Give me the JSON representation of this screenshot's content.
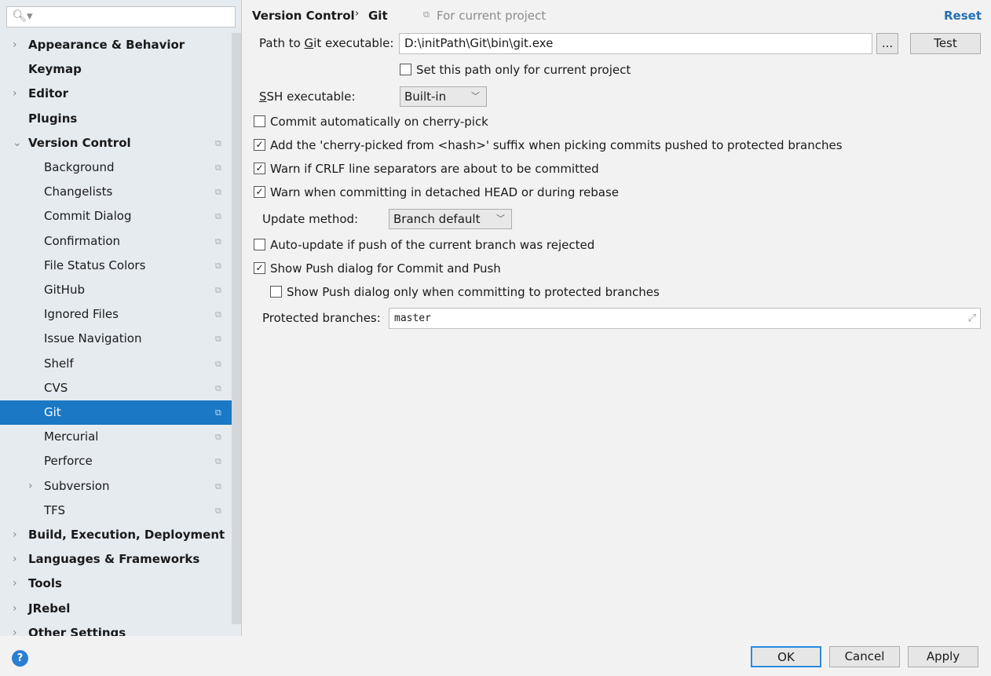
{
  "sidebar": {
    "search_placeholder": "",
    "items": [
      {
        "label": "Appearance & Behavior",
        "level": "top",
        "arrow": "›"
      },
      {
        "label": "Keymap",
        "level": "top",
        "arrow": ""
      },
      {
        "label": "Editor",
        "level": "top",
        "arrow": "›"
      },
      {
        "label": "Plugins",
        "level": "top",
        "arrow": ""
      },
      {
        "label": "Version Control",
        "level": "top",
        "arrow": "⌄",
        "copy": true
      },
      {
        "label": "Background",
        "level": "sub",
        "copy": true
      },
      {
        "label": "Changelists",
        "level": "sub",
        "copy": true
      },
      {
        "label": "Commit Dialog",
        "level": "sub",
        "copy": true
      },
      {
        "label": "Confirmation",
        "level": "sub",
        "copy": true
      },
      {
        "label": "File Status Colors",
        "level": "sub",
        "copy": true
      },
      {
        "label": "GitHub",
        "level": "sub",
        "copy": true
      },
      {
        "label": "Ignored Files",
        "level": "sub",
        "copy": true
      },
      {
        "label": "Issue Navigation",
        "level": "sub",
        "copy": true
      },
      {
        "label": "Shelf",
        "level": "sub",
        "copy": true
      },
      {
        "label": "CVS",
        "level": "sub",
        "copy": true
      },
      {
        "label": "Git",
        "level": "sub",
        "copy": true,
        "selected": true
      },
      {
        "label": "Mercurial",
        "level": "sub",
        "copy": true
      },
      {
        "label": "Perforce",
        "level": "sub",
        "copy": true
      },
      {
        "label": "Subversion",
        "level": "sub",
        "copy": true,
        "arrow": "›"
      },
      {
        "label": "TFS",
        "level": "sub",
        "copy": true
      },
      {
        "label": "Build, Execution, Deployment",
        "level": "top",
        "arrow": "›"
      },
      {
        "label": "Languages & Frameworks",
        "level": "top",
        "arrow": "›"
      },
      {
        "label": "Tools",
        "level": "top",
        "arrow": "›"
      },
      {
        "label": "JRebel",
        "level": "top",
        "arrow": "›"
      },
      {
        "label": "Other Settings",
        "level": "top",
        "arrow": "›"
      }
    ]
  },
  "header": {
    "crumb1": "Version Control",
    "sep": "›",
    "crumb2": "Git",
    "scope": "For current project",
    "reset": "Reset"
  },
  "form": {
    "git_path_label_pre": "Path to ",
    "git_path_label_u": "G",
    "git_path_label_post": "it executable:",
    "git_path_value": "D:\\initPath\\Git\\bin\\git.exe",
    "browse": "...",
    "test": "Test",
    "project_only": {
      "label": "Set this path only for current project",
      "checked": false
    },
    "ssh_label_u": "S",
    "ssh_label_post": "SH executable:",
    "ssh_value": "Built-in",
    "checks": [
      {
        "label": "Commit automatically on cherry-pick",
        "checked": false
      },
      {
        "label": "Add the 'cherry-picked from <hash>' suffix when picking commits pushed to protected branches",
        "checked": true
      },
      {
        "label": "Warn if CRLF line separators are about to be committed",
        "checked": true
      },
      {
        "label": "Warn when committing in detached HEAD or during rebase",
        "checked": true
      }
    ],
    "update_label": "Update method:",
    "update_value": "Branch default",
    "checks2": [
      {
        "label": "Auto-update if push of the current branch was rejected",
        "checked": false
      },
      {
        "label": "Show Push dialog for Commit and Push",
        "checked": true
      },
      {
        "label": "Show Push dialog only when committing to protected branches",
        "checked": false
      }
    ],
    "protected_label": "Protected branches:",
    "protected_value": "master"
  },
  "footer": {
    "ok": "OK",
    "cancel": "Cancel",
    "apply": "Apply",
    "help": "?"
  },
  "colors": {
    "selection": "#1a78c4",
    "link": "#2470b3"
  }
}
